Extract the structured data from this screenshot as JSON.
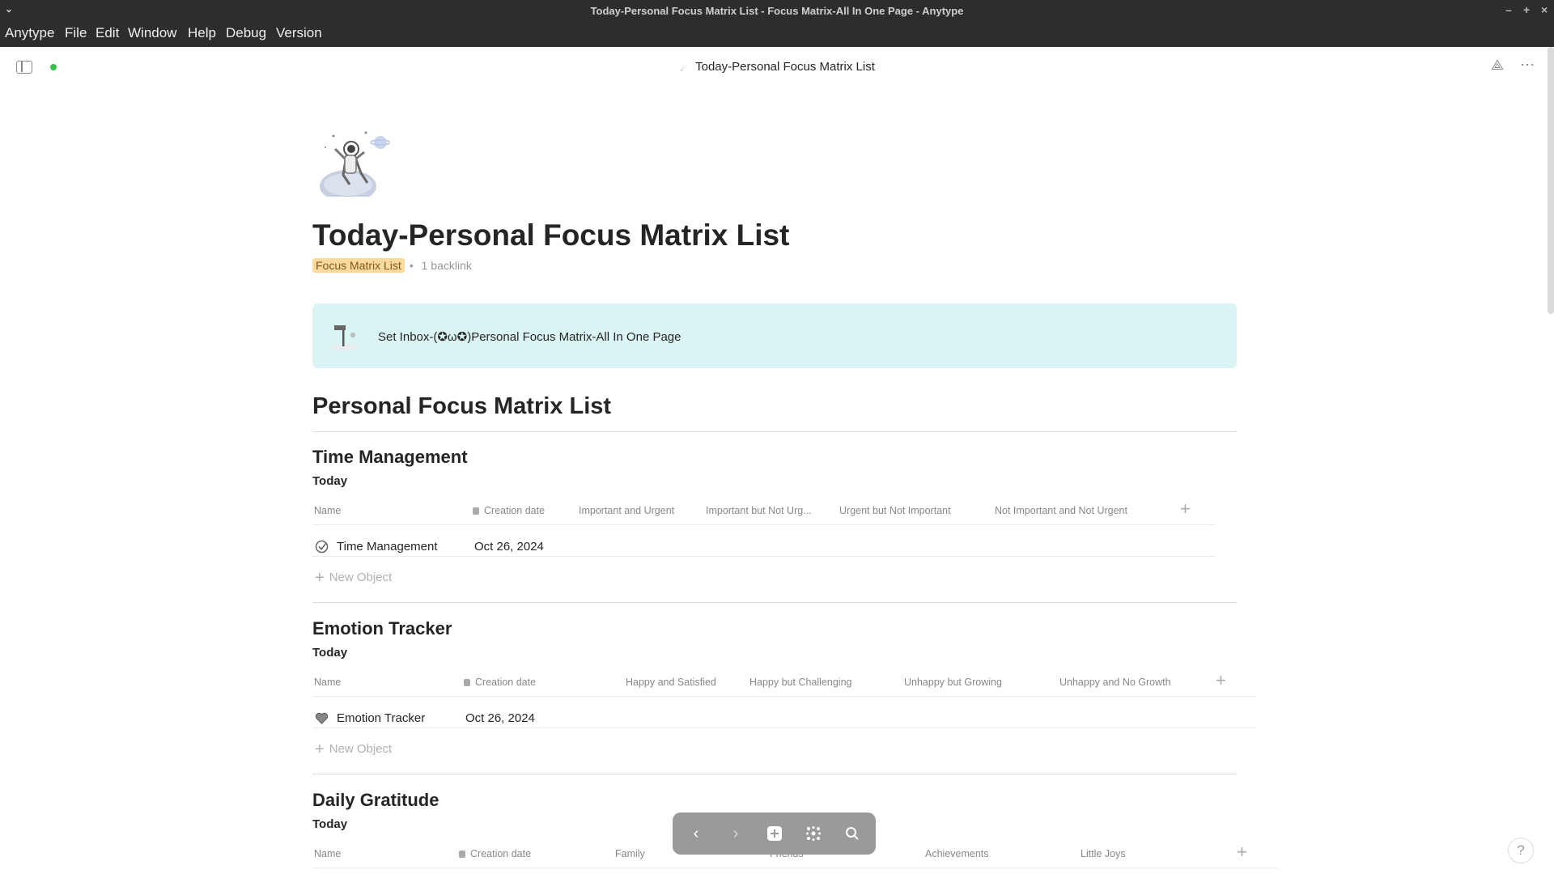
{
  "window": {
    "title": "Today-Personal Focus Matrix List - Focus Matrix-All In One Page - Anytype"
  },
  "menu": [
    "Anytype",
    "File",
    "Edit",
    "Window",
    "Help",
    "Debug",
    "Version"
  ],
  "header": {
    "title": "Today-Personal Focus Matrix List"
  },
  "page": {
    "title": "Today-Personal Focus Matrix List",
    "type": "Focus Matrix List",
    "separator": "•",
    "backlinks": "1 backlink",
    "callout": "Set Inbox-(✪ω✪)Personal Focus Matrix-All In One Page",
    "heading": "Personal Focus Matrix List"
  },
  "sections": [
    {
      "title": "Time Management",
      "view": "Today",
      "columns": [
        "Name",
        "Creation date",
        "Important and Urgent",
        "Important but Not Urg...",
        "Urgent but Not Important",
        "Not Important and Not Urgent"
      ],
      "rows": [
        {
          "name": "Time Management",
          "date": "Oct 26, 2024",
          "icon": "checkmark-circle-icon"
        }
      ],
      "new_object": "New Object"
    },
    {
      "title": "Emotion Tracker",
      "view": "Today",
      "columns": [
        "Name",
        "Creation date",
        "Happy and Satisfied",
        "Happy but Challenging",
        "Unhappy but Growing",
        "Unhappy and No Growth"
      ],
      "rows": [
        {
          "name": "Emotion Tracker",
          "date": "Oct 26, 2024",
          "icon": "heart-icon"
        }
      ],
      "new_object": "New Object"
    },
    {
      "title": "Daily Gratitude",
      "view": "Today",
      "columns": [
        "Name",
        "Creation date",
        "Family",
        "Friends",
        "Achievements",
        "Little Joys"
      ]
    }
  ],
  "navbar": [
    "back-icon",
    "forward-icon",
    "plus-icon",
    "graph-icon",
    "search-icon"
  ],
  "help": "?"
}
